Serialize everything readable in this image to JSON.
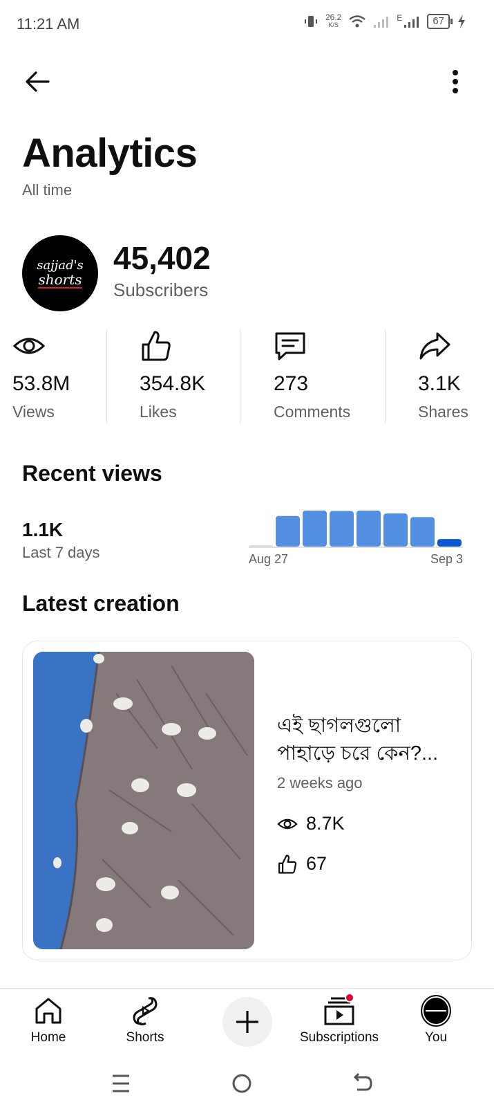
{
  "status_bar": {
    "time": "11:21 AM",
    "net_speed_value": "26.2",
    "net_speed_unit": "K/S",
    "network_type": "E",
    "battery": "67"
  },
  "header": {
    "back_icon": "arrow-left-icon",
    "more_icon": "more-vertical-icon"
  },
  "page": {
    "title": "Analytics",
    "subtitle": "All time"
  },
  "channel": {
    "avatar_line1": "sajjad's",
    "avatar_line2": "shorts",
    "subscribers_value": "45,402",
    "subscribers_label": "Subscribers"
  },
  "stats": [
    {
      "icon": "eye-icon",
      "value": "53.8M",
      "label": "Views"
    },
    {
      "icon": "thumbs-up-icon",
      "value": "354.8K",
      "label": "Likes"
    },
    {
      "icon": "comment-icon",
      "value": "273",
      "label": "Comments"
    },
    {
      "icon": "share-icon",
      "value": "3.1K",
      "label": "Shares"
    }
  ],
  "recent_views": {
    "title": "Recent views",
    "value": "1.1K",
    "label": "Last 7 days",
    "start_label": "Aug 27",
    "end_label": "Sep 3",
    "bar_color": "#5390e1",
    "highlight_color": "#0b57d0"
  },
  "chart_data": {
    "type": "bar",
    "categories": [
      "Aug 27",
      "Aug 28",
      "Aug 29",
      "Aug 30",
      "Aug 31",
      "Sep 1",
      "Sep 2",
      "Sep 3"
    ],
    "values": [
      3,
      85,
      100,
      99,
      100,
      92,
      82,
      21
    ],
    "ylim": [
      0,
      100
    ],
    "x_tick_labels": [
      "Aug 27",
      "Sep 3"
    ],
    "grid": false,
    "legend": "none"
  },
  "latest_creation": {
    "title": "Latest creation",
    "video_title": "এই ছাগলগুলো পাহাড়ে চরে কেন?...",
    "age": "2 weeks ago",
    "views": "8.7K",
    "likes": "67"
  },
  "bottom_nav": {
    "home": "Home",
    "shorts": "Shorts",
    "subscriptions": "Subscriptions",
    "you": "You"
  }
}
